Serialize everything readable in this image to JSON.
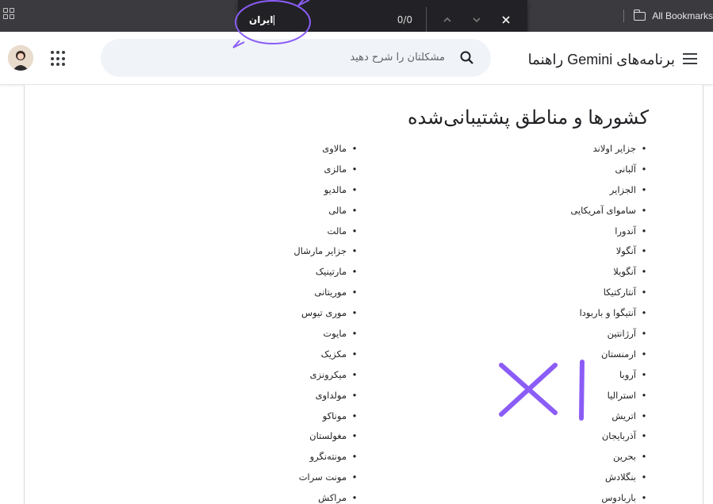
{
  "browser": {
    "bookmarks_label": "All Bookmarks",
    "find_bar": {
      "query": "ایران",
      "match_count": "0/0"
    }
  },
  "header": {
    "product_title": "برنامه‌های Gemini راهنما",
    "search_placeholder": "مشکلتان را شرح دهید"
  },
  "main": {
    "section_title": "کشورها و مناطق پشتیبانی‌شده",
    "countries_right": [
      "جزایر اولاند",
      "آلبانی",
      "الجزایر",
      "ساموای آمریکایی",
      "آندورا",
      "آنگولا",
      "آنگویلا",
      "آنتارکتیکا",
      "آنتیگوا و باربودا",
      "آرژانتین",
      "ارمنستان",
      "آروبا",
      "استرالیا",
      "اتریش",
      "آذربایجان",
      "بحرین",
      "بنگلادش",
      "باربادوس"
    ],
    "countries_left": [
      "مالاوی",
      "مالزی",
      "مالدیو",
      "مالی",
      "مالت",
      "جزایر مارشال",
      "مارتینیک",
      "موریتانی",
      "موری تیوس",
      "مایوت",
      "مکزیک",
      "میکرونزی",
      "مولداوی",
      "موناکو",
      "مغولستان",
      "مونته‌نگرو",
      "مونت سرات",
      "مراکش"
    ]
  },
  "annotation": {
    "stroke_color": "#8b5cf6"
  }
}
